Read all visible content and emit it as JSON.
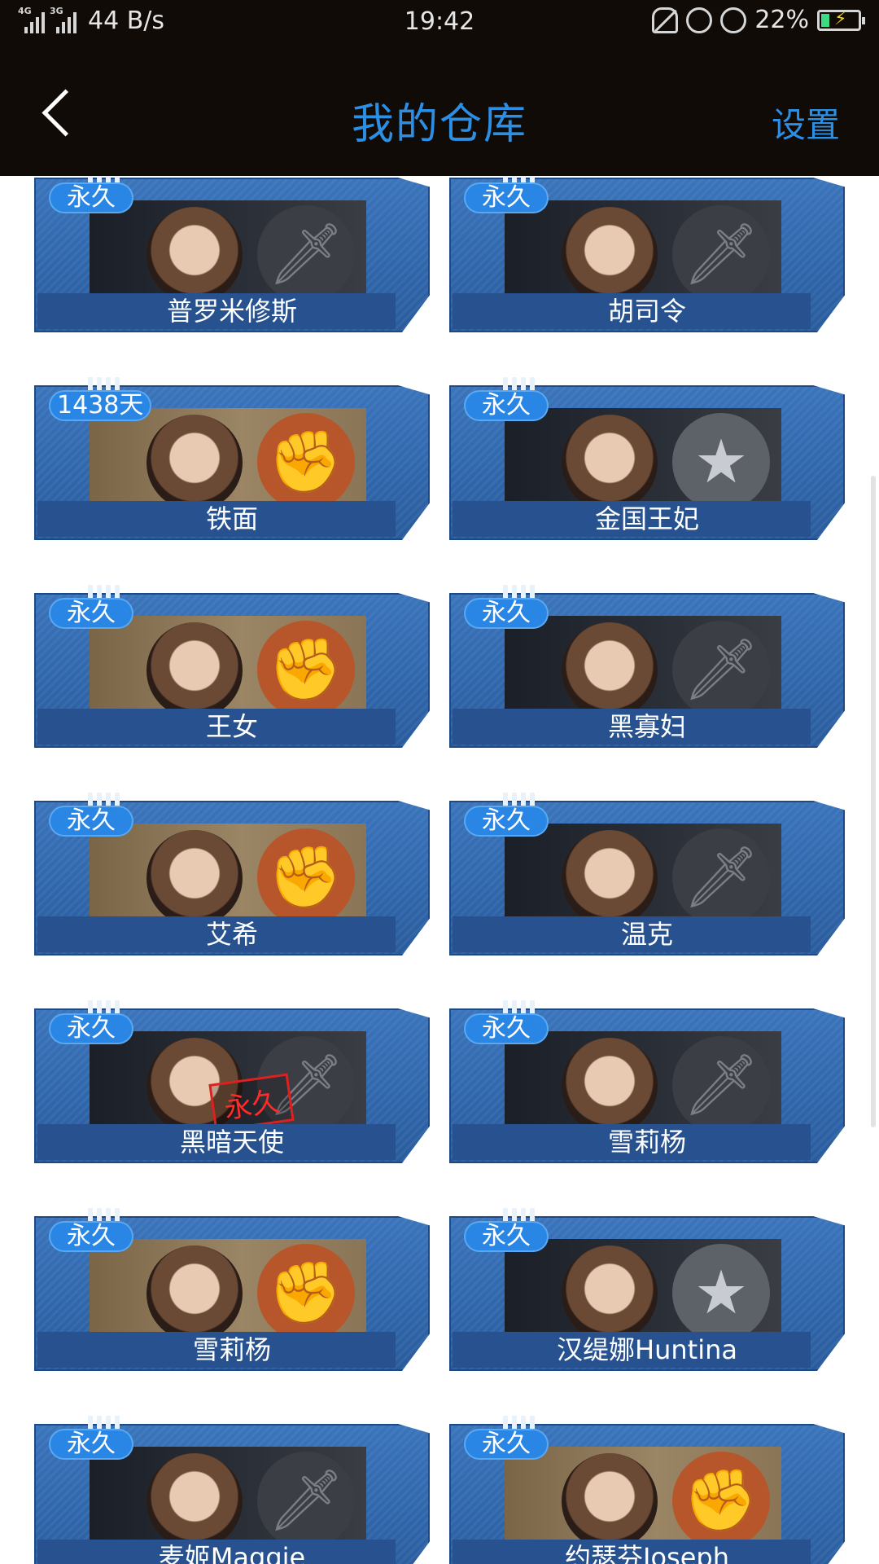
{
  "status_bar": {
    "signal_left_tag": "4G",
    "signal_right_tag": "3G",
    "network_speed": "44 B/s",
    "time": "19:42",
    "battery_percent": "22%",
    "battery_level": 0.22,
    "icons": [
      "mute-icon",
      "rotation-lock-icon",
      "alarm-icon",
      "battery-charging-icon"
    ]
  },
  "header": {
    "title": "我的仓库",
    "settings_label": "设置",
    "back_icon": "chevron-left-icon"
  },
  "colors": {
    "accent": "#2b8fe6",
    "header_bg": "#100b07",
    "card_blue": "#3a74bb",
    "badge_blue": "#2a86e4"
  },
  "items": [
    {
      "name": "普罗米修斯",
      "duration": "永久",
      "emblem": "sword",
      "bg": "dark"
    },
    {
      "name": "胡司令",
      "duration": "永久",
      "emblem": "sword",
      "bg": "dark"
    },
    {
      "name": "铁面",
      "duration": "1438天",
      "emblem": "fist",
      "bg": "warm"
    },
    {
      "name": "金国王妃",
      "duration": "永久",
      "emblem": "star",
      "bg": "dark"
    },
    {
      "name": "王女",
      "duration": "永久",
      "emblem": "fist",
      "bg": "warm"
    },
    {
      "name": "黑寡妇",
      "duration": "永久",
      "emblem": "sword",
      "bg": "dark"
    },
    {
      "name": "艾希",
      "duration": "永久",
      "emblem": "fist",
      "bg": "warm"
    },
    {
      "name": "温克",
      "duration": "永久",
      "emblem": "sword",
      "bg": "dark"
    },
    {
      "name": "黑暗天使",
      "duration": "永久",
      "emblem": "sword",
      "bg": "dark",
      "stamp": "永久"
    },
    {
      "name": "雪莉杨",
      "duration": "永久",
      "emblem": "sword",
      "bg": "dark"
    },
    {
      "name": "雪莉杨",
      "duration": "永久",
      "emblem": "fist",
      "bg": "warm"
    },
    {
      "name": "汉缇娜Huntina",
      "duration": "永久",
      "emblem": "star",
      "bg": "dark"
    },
    {
      "name": "麦姬Maggie",
      "duration": "永久",
      "emblem": "sword",
      "bg": "dark"
    },
    {
      "name": "约瑟芬Joseph",
      "duration": "永久",
      "emblem": "fist",
      "bg": "warm"
    }
  ]
}
